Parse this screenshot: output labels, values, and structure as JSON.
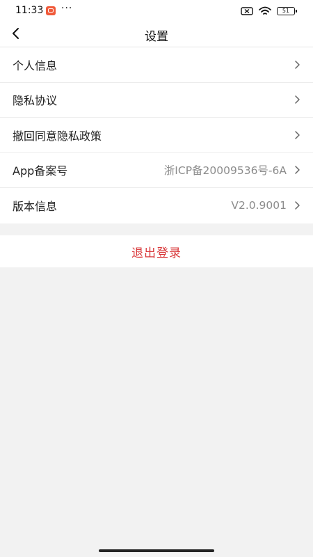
{
  "status_bar": {
    "time": "11:33",
    "more": "···",
    "battery": "51"
  },
  "header": {
    "title": "设置"
  },
  "menu": [
    {
      "label": "个人信息",
      "value": ""
    },
    {
      "label": "隐私协议",
      "value": ""
    },
    {
      "label": "撤回同意隐私政策",
      "value": ""
    },
    {
      "label": "App备案号",
      "value": "浙ICP备20009536号-6A"
    },
    {
      "label": "版本信息",
      "value": "V2.0.9001"
    }
  ],
  "logout": {
    "label": "退出登录",
    "color": "#d9383a"
  }
}
